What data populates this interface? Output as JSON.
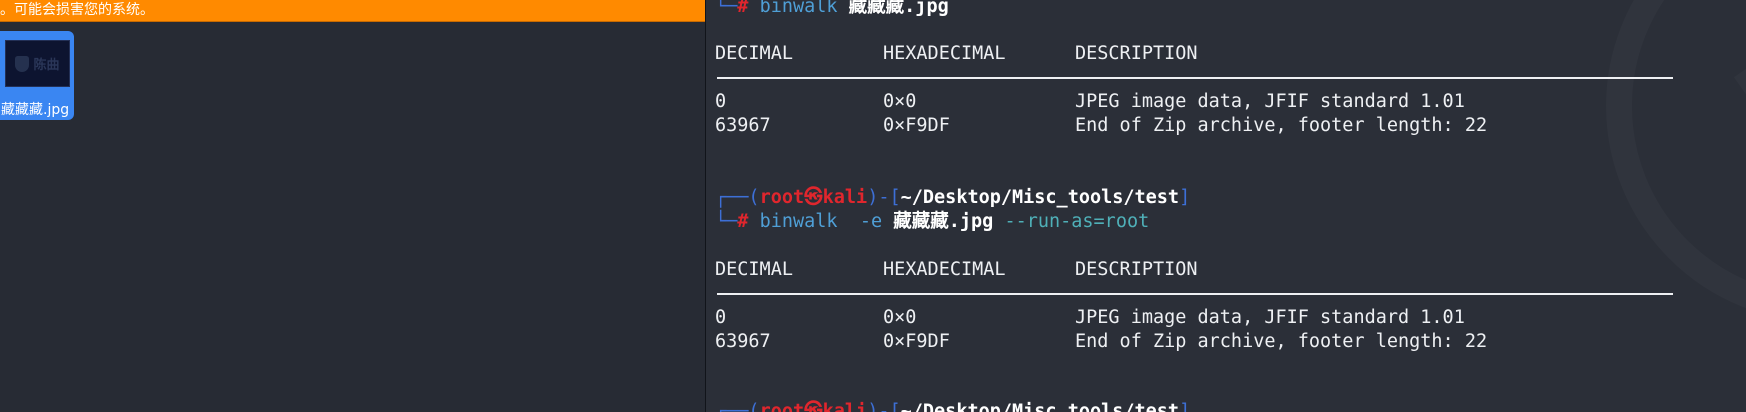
{
  "desktop": {
    "warning_text": "。可能会损害您的系统。",
    "file_icon": {
      "label": "藏藏藏.jpg",
      "thumbnail_icon": "image-thumbnail-icon",
      "thumbnail_text": "陈曲"
    }
  },
  "terminal": {
    "prompt": {
      "bracket_open": "┌──(",
      "user": "root",
      "skull": "㉿",
      "host": "kali",
      "mid": ")-[",
      "cwd": "~/Desktop/Misc_tools/test",
      "bracket_close": "]",
      "cont": "└─",
      "hash": "#"
    },
    "cmd1": {
      "bin": "binwalk",
      "file": "藏藏藏.jpg"
    },
    "cmd2": {
      "bin": "binwalk",
      "flag": "-e",
      "file": "藏藏藏.jpg",
      "opt": "--run-as=root"
    },
    "headers": [
      "DECIMAL",
      "HEXADECIMAL",
      "DESCRIPTION"
    ],
    "rows": [
      {
        "dec": "0",
        "hex": "0×0",
        "desc": "JPEG image data, JFIF standard 1.01"
      },
      {
        "dec": "63967",
        "hex": "0×F9DF",
        "desc": "End of Zip archive, footer length: 22"
      }
    ]
  }
}
